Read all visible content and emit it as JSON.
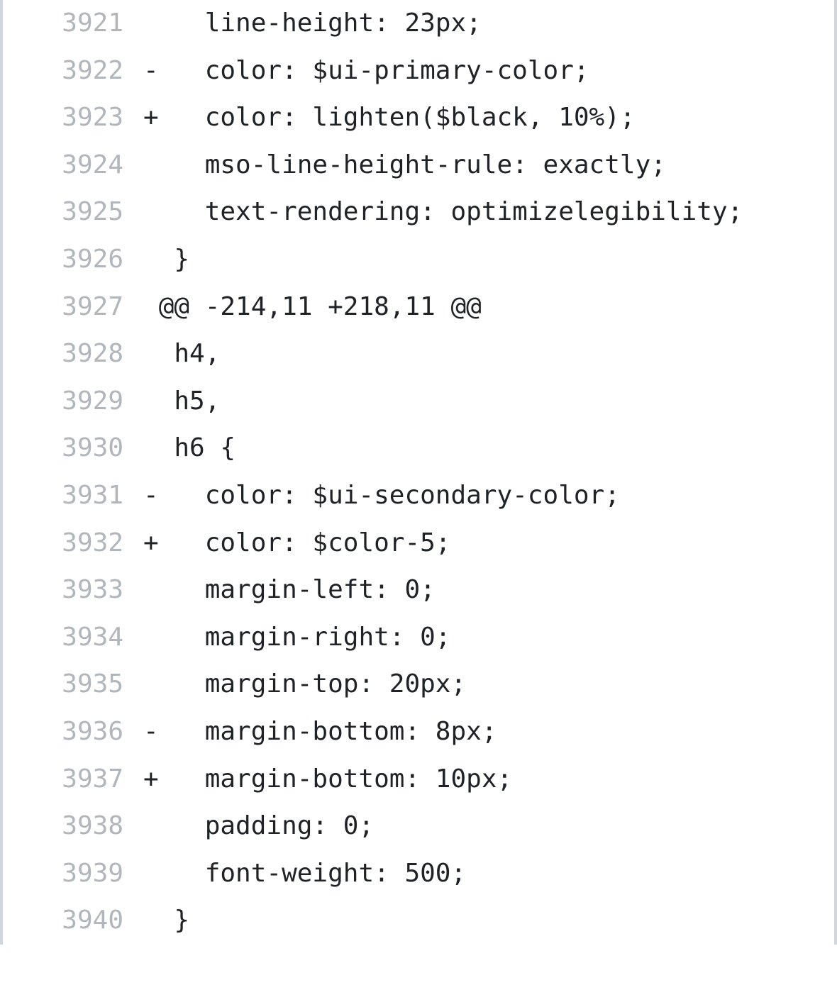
{
  "lines": [
    {
      "n": "3921",
      "c": "    line-height: 23px;"
    },
    {
      "n": "3922",
      "c": "-   color: $ui-primary-color;"
    },
    {
      "n": "3923",
      "c": "+   color: lighten($black, 10%);"
    },
    {
      "n": "3924",
      "c": "    mso-line-height-rule: exactly;"
    },
    {
      "n": "3925",
      "c": "    text-rendering: optimizelegibility;"
    },
    {
      "n": "3926",
      "c": "  }"
    },
    {
      "n": "3927",
      "c": " @@ -214,11 +218,11 @@"
    },
    {
      "n": "3928",
      "c": "  h4,"
    },
    {
      "n": "3929",
      "c": "  h5,"
    },
    {
      "n": "3930",
      "c": "  h6 {"
    },
    {
      "n": "3931",
      "c": "-   color: $ui-secondary-color;"
    },
    {
      "n": "3932",
      "c": "+   color: $color-5;"
    },
    {
      "n": "3933",
      "c": "    margin-left: 0;"
    },
    {
      "n": "3934",
      "c": "    margin-right: 0;"
    },
    {
      "n": "3935",
      "c": "    margin-top: 20px;"
    },
    {
      "n": "3936",
      "c": "-   margin-bottom: 8px;"
    },
    {
      "n": "3937",
      "c": "+   margin-bottom: 10px;"
    },
    {
      "n": "3938",
      "c": "    padding: 0;"
    },
    {
      "n": "3939",
      "c": "    font-weight: 500;"
    },
    {
      "n": "3940",
      "c": "  }"
    }
  ]
}
